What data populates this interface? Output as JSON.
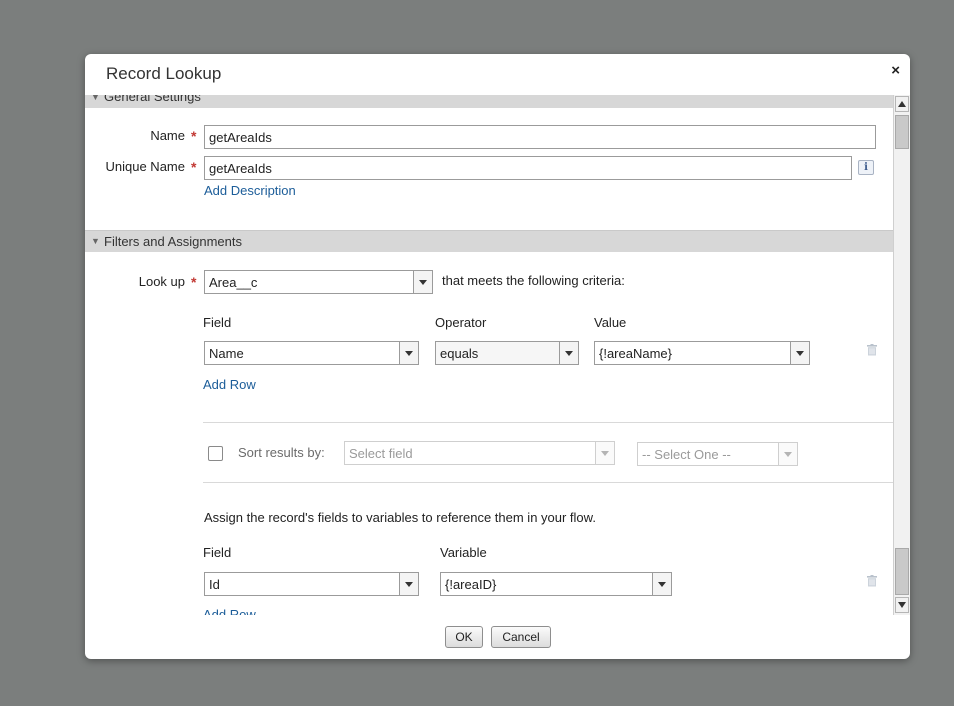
{
  "dialog": {
    "title": "Record Lookup",
    "close_glyph": "×"
  },
  "general_settings": {
    "header": "General Settings",
    "name_label": "Name",
    "name_value": "getAreaIds",
    "unique_name_label": "Unique Name",
    "unique_name_value": "getAreaIds",
    "info_glyph": "i",
    "add_description": "Add Description"
  },
  "filters": {
    "header": "Filters and Assignments",
    "lookup_label": "Look up",
    "lookup_value": "Area__c",
    "lookup_suffix": "that meets the following criteria:",
    "col_field": "Field",
    "col_operator": "Operator",
    "col_value": "Value",
    "rows": [
      {
        "field": "Name",
        "operator": "equals",
        "value": "{!areaName}"
      }
    ],
    "add_row": "Add Row",
    "sort_label": "Sort results by:",
    "sort_field_placeholder": "Select field",
    "sort_order_placeholder": "-- Select One --",
    "assign_text": "Assign the record's fields to variables to reference them in your flow.",
    "assign_col_field": "Field",
    "assign_col_variable": "Variable",
    "assignments": [
      {
        "field": "Id",
        "variable": "{!areaID}"
      }
    ],
    "assign_add_row": "Add Row"
  },
  "footer": {
    "ok": "OK",
    "cancel": "Cancel"
  },
  "icons": {
    "required": "required-asterisk-icon",
    "info": "info-icon",
    "trash": "trash-icon",
    "collapse": "triangle-down-icon",
    "dropdown": "chevron-down-icon"
  },
  "colors": {
    "overlay": "#7b7e7d",
    "section_bar": "#d7d7d7",
    "link": "#1c5d99",
    "required": "#c23934"
  }
}
